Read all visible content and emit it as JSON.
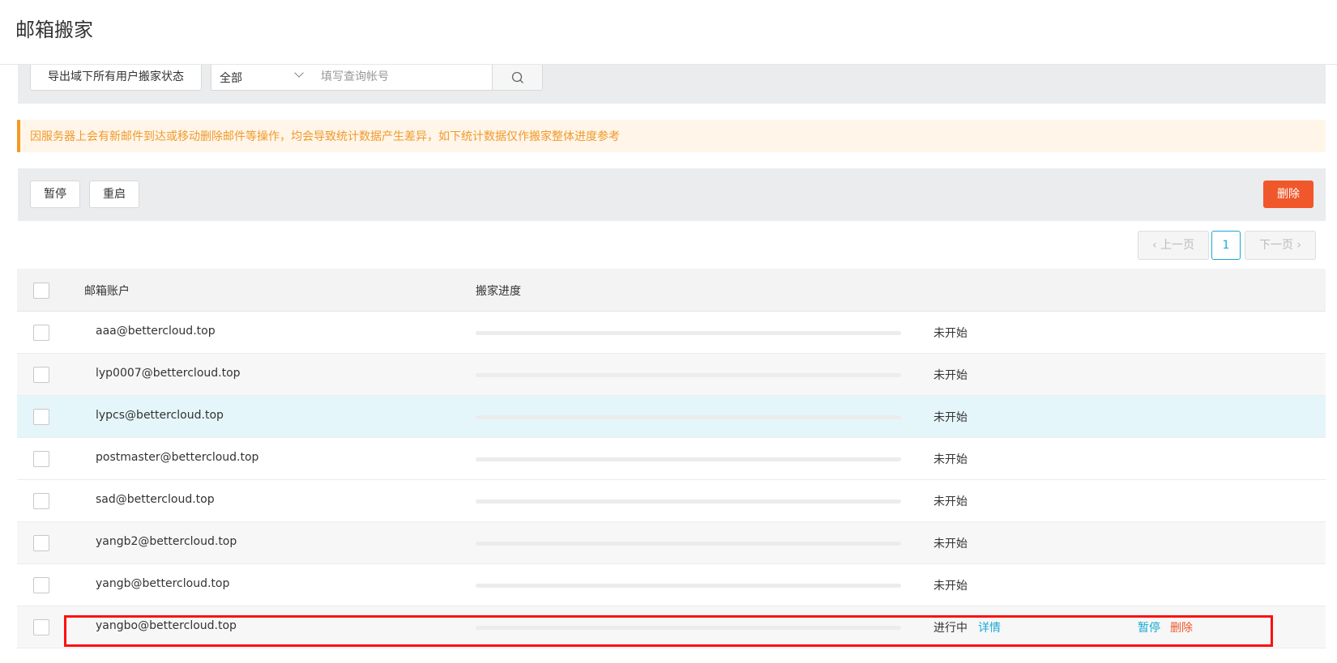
{
  "header": {
    "title": "邮箱搬家"
  },
  "toolbar": {
    "export_label": "导出域下所有用户搬家状态",
    "filter_selected": "全部",
    "search_placeholder": "填写查询帐号"
  },
  "notice": "因服务器上会有新邮件到达或移动删除邮件等操作，均会导致统计数据产生差异，如下统计数据仅作搬家整体进度参考",
  "actions": {
    "pause_label": "暂停",
    "restart_label": "重启",
    "delete_label": "删除"
  },
  "pagination": {
    "prev_label": "‹ 上一页",
    "current_page": "1",
    "next_label": "下一页 ›"
  },
  "table": {
    "headers": {
      "account": "邮箱账户",
      "progress": "搬家进度"
    },
    "rows": [
      {
        "account": "aaa@bettercloud.top",
        "progress": 0,
        "status": "未开始"
      },
      {
        "account": "lyp0007@bettercloud.top",
        "progress": 0,
        "status": "未开始"
      },
      {
        "account": "lypcs@bettercloud.top",
        "progress": 0,
        "status": "未开始"
      },
      {
        "account": "postmaster@bettercloud.top",
        "progress": 0,
        "status": "未开始"
      },
      {
        "account": "sad@bettercloud.top",
        "progress": 0,
        "status": "未开始"
      },
      {
        "account": "yangb2@bettercloud.top",
        "progress": 0,
        "status": "未开始"
      },
      {
        "account": "yangb@bettercloud.top",
        "progress": 0,
        "status": "未开始"
      },
      {
        "account": "yangbo@bettercloud.top",
        "progress": 0,
        "status": "进行中",
        "detail": "详情",
        "pause": "暂停",
        "delete": "删除"
      }
    ]
  },
  "colors": {
    "accent": "#19a9d5",
    "danger": "#f0572a",
    "warning": "#f09a2a"
  }
}
